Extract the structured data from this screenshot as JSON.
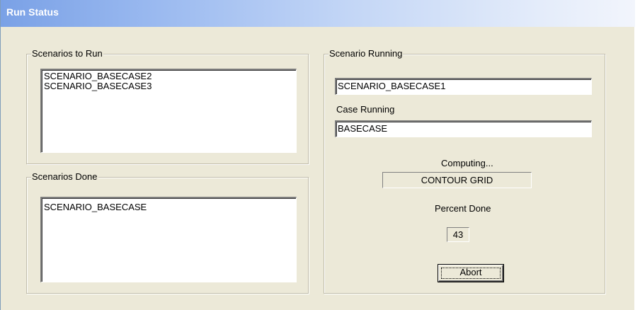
{
  "window": {
    "title": "Run Status"
  },
  "scenarios_to_run": {
    "label": "Scenarios to Run",
    "items": [
      "SCENARIO_BASECASE2",
      "SCENARIO_BASECASE3"
    ]
  },
  "scenarios_done": {
    "label": "Scenarios Done",
    "items": [
      "SCENARIO_BASECASE"
    ]
  },
  "scenario_running": {
    "label": "Scenario Running",
    "value": "SCENARIO_BASECASE1",
    "case_label": "Case Running",
    "case_value": "BASECASE",
    "computing_label": "Computing...",
    "computing_value": "CONTOUR GRID",
    "percent_label": "Percent Done",
    "percent_value": "43",
    "abort_label": "Abort"
  }
}
